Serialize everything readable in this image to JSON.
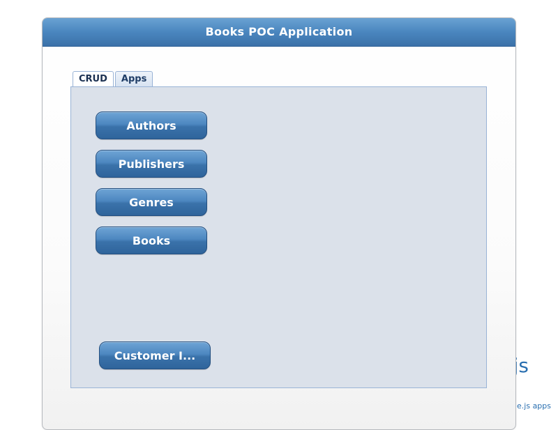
{
  "background": {
    "brand_fragment": "js",
    "tagline_fragment": "e.js apps"
  },
  "window": {
    "title": "Books POC Application"
  },
  "tabs": [
    {
      "label": "CRUD",
      "active": true
    },
    {
      "label": "Apps",
      "active": false
    }
  ],
  "crud": {
    "buttons": [
      {
        "label": "Authors"
      },
      {
        "label": "Publishers"
      },
      {
        "label": "Genres"
      },
      {
        "label": "Books"
      }
    ],
    "customer_button": {
      "label": "Customer I..."
    }
  },
  "colors": {
    "accent": "#4a86bf",
    "panel_bg": "#dbe1ea",
    "brand_text": "#2a6fb0"
  }
}
